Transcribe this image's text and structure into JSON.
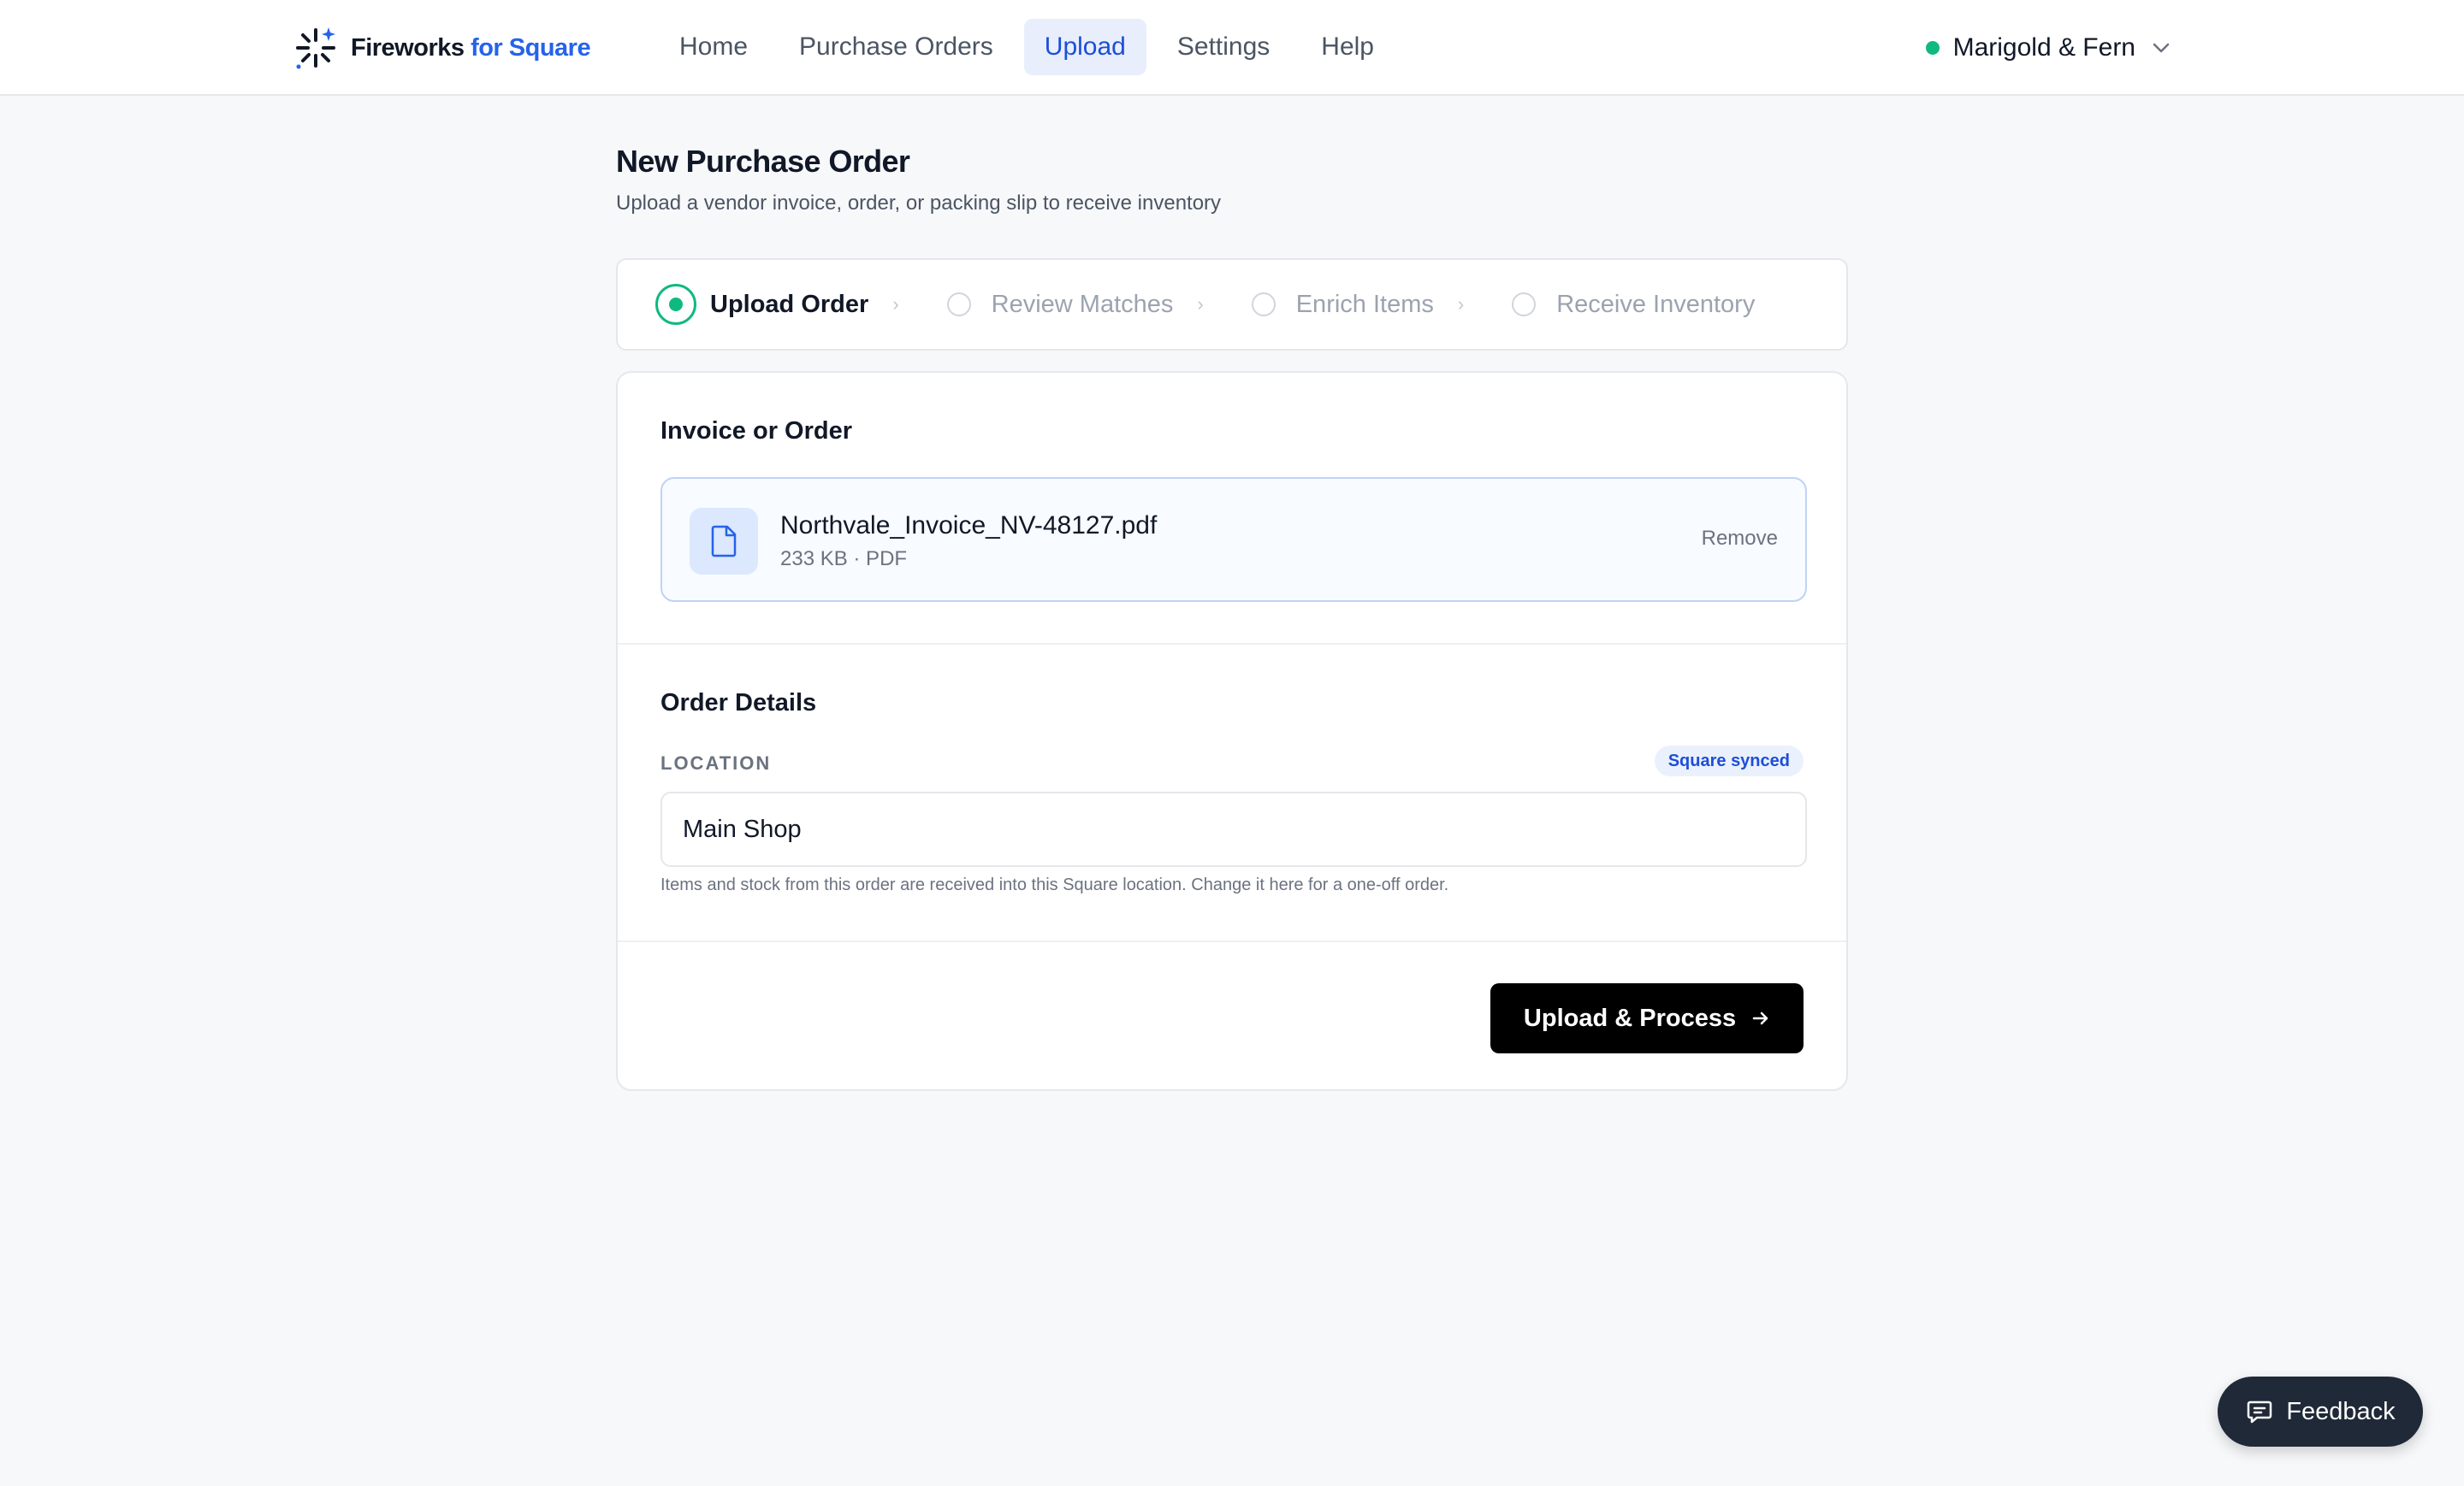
{
  "brand": {
    "name_part1": "Fireworks",
    "name_part2": "for Square"
  },
  "nav": {
    "items": [
      {
        "label": "Home",
        "active": false
      },
      {
        "label": "Purchase Orders",
        "active": false
      },
      {
        "label": "Upload",
        "active": true
      },
      {
        "label": "Settings",
        "active": false
      },
      {
        "label": "Help",
        "active": false
      }
    ]
  },
  "account": {
    "name": "Marigold & Fern",
    "status_color": "#10b981"
  },
  "page": {
    "title": "New Purchase Order",
    "subtitle": "Upload a vendor invoice, order, or packing slip to receive inventory"
  },
  "stepper": {
    "steps": [
      {
        "label": "Upload Order",
        "state": "active"
      },
      {
        "label": "Review Matches",
        "state": "pending"
      },
      {
        "label": "Enrich Items",
        "state": "pending"
      },
      {
        "label": "Receive Inventory",
        "state": "pending"
      }
    ]
  },
  "invoice": {
    "section_title": "Invoice or Order",
    "file_name": "Northvale_Invoice_NV-48127.pdf",
    "file_meta": "233 KB · PDF",
    "remove_label": "Remove"
  },
  "order_details": {
    "section_title": "Order Details",
    "location_label": "LOCATION",
    "synced_badge": "Square synced",
    "location_value": "Main Shop",
    "help_text": "Items and stock from this order are received into this Square location. Change it here for a one-off order."
  },
  "actions": {
    "submit_label": "Upload & Process"
  },
  "feedback": {
    "label": "Feedback"
  },
  "colors": {
    "accent_blue": "#2563eb",
    "success_green": "#10b981",
    "primary_button": "#000000"
  }
}
